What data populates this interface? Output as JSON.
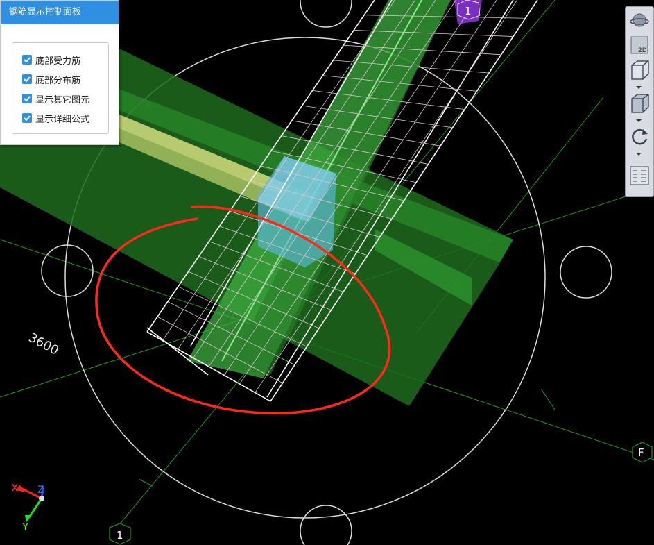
{
  "panel": {
    "title": "钢筋显示控制面板",
    "options": [
      {
        "label": "底部受力筋",
        "checked": true
      },
      {
        "label": "底部分布筋",
        "checked": true
      },
      {
        "label": "显示其它图元",
        "checked": true
      },
      {
        "label": "显示详细公式",
        "checked": true
      }
    ]
  },
  "viewport": {
    "dimension_label": "3600",
    "axis_markers": {
      "top": "1",
      "bottom": "1",
      "right": "F"
    },
    "triad": {
      "x": "X",
      "y": "Y",
      "z": "Z"
    }
  },
  "toolbar": {
    "view_2d_label": "2D",
    "icons": [
      "orbit-icon",
      "view-2d-icon",
      "wireframe-box-icon",
      "solid-box-icon",
      "rotate-icon",
      "properties-list-icon"
    ]
  },
  "colors": {
    "panel_title_bg": "#2f8fe0",
    "checkbox": "#2f8fe0",
    "annotation_red": "#ff2a1a",
    "grid_green": "#1a9a1a"
  }
}
